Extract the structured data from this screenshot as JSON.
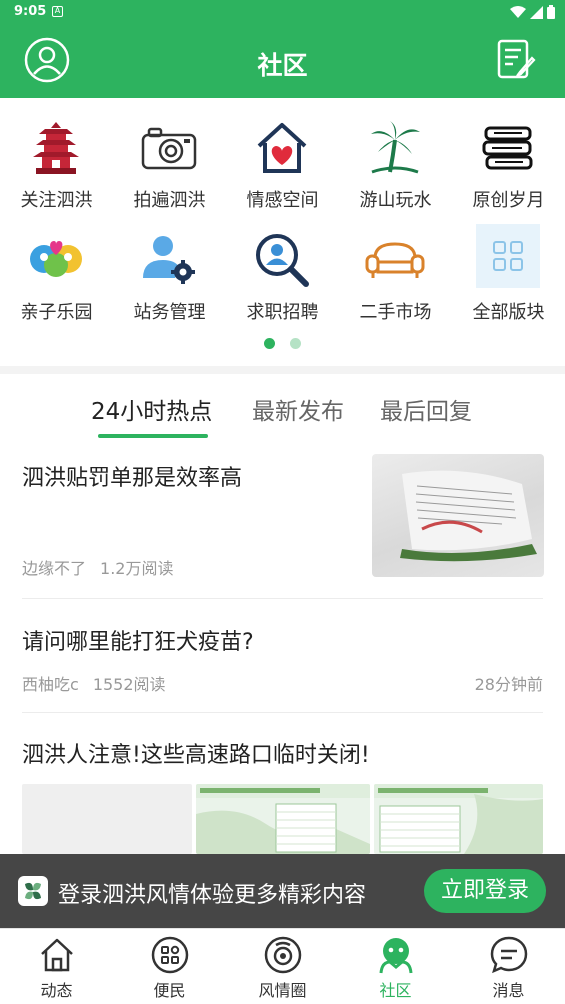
{
  "status_bar": {
    "time": "9:05",
    "badge": "A"
  },
  "header": {
    "title": "社区"
  },
  "categories": [
    {
      "label": "关注泗洪",
      "icon": "pagoda-icon"
    },
    {
      "label": "拍遍泗洪",
      "icon": "camera-icon"
    },
    {
      "label": "情感空间",
      "icon": "heart-house-icon"
    },
    {
      "label": "游山玩水",
      "icon": "palm-tree-icon"
    },
    {
      "label": "原创岁月",
      "icon": "books-icon"
    },
    {
      "label": "亲子乐园",
      "icon": "family-icon"
    },
    {
      "label": "站务管理",
      "icon": "user-gear-icon"
    },
    {
      "label": "求职招聘",
      "icon": "job-search-icon"
    },
    {
      "label": "二手市场",
      "icon": "sofa-icon"
    },
    {
      "label": "全部版块",
      "icon": "grid-icon"
    }
  ],
  "pager": {
    "total": 2,
    "active": 0
  },
  "tabs": [
    {
      "label": "24小时热点",
      "active": true
    },
    {
      "label": "最新发布",
      "active": false
    },
    {
      "label": "最后回复",
      "active": false
    }
  ],
  "posts": [
    {
      "title": "泗洪贴罚单那是效率高",
      "author": "边缘不了",
      "reads": "1.2万阅读",
      "time": ""
    },
    {
      "title": "请问哪里能打狂犬疫苗?",
      "author": "西柚吃c",
      "reads": "1552阅读",
      "time": "28分钟前"
    },
    {
      "title": "泗洪人注意!这些高速路口临时关闭!",
      "author": "",
      "reads": "",
      "time": ""
    }
  ],
  "login_banner": {
    "text": "登录泗洪风情体验更多精彩内容",
    "button": "立即登录"
  },
  "bottom_nav": [
    {
      "label": "动态",
      "icon": "house-icon",
      "active": false
    },
    {
      "label": "便民",
      "icon": "apps-icon",
      "active": false
    },
    {
      "label": "风情圈",
      "icon": "camera-circle-icon",
      "active": false
    },
    {
      "label": "社区",
      "icon": "community-icon",
      "active": true
    },
    {
      "label": "消息",
      "icon": "message-icon",
      "active": false
    }
  ],
  "colors": {
    "brand": "#2db35f",
    "text": "#222222",
    "muted": "#999999"
  }
}
